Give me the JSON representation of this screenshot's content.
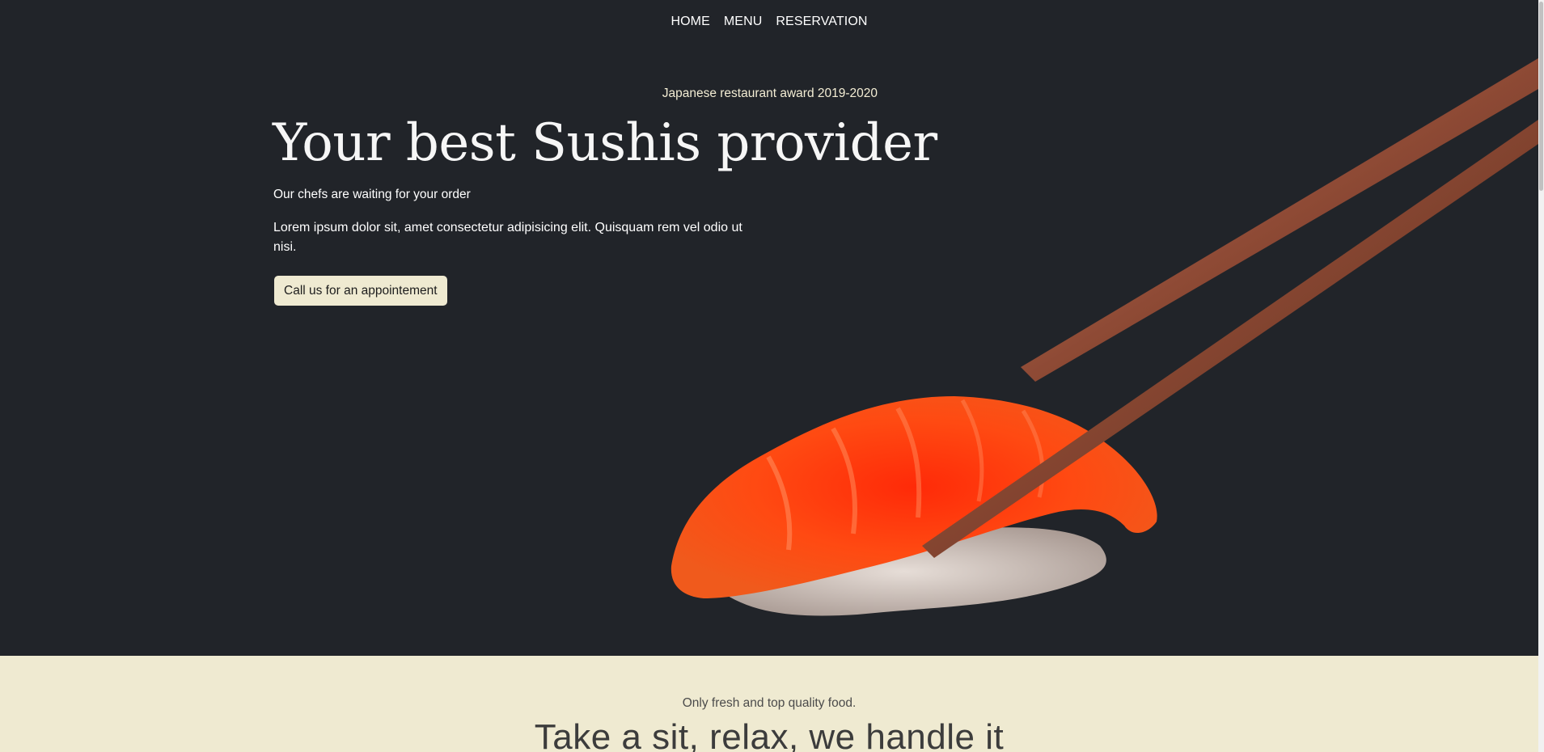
{
  "nav": {
    "items": [
      "HOME",
      "MENU",
      "RESERVATION"
    ]
  },
  "hero": {
    "award": "Japanese restaurant award 2019-2020",
    "headline": "Your best Sushis provider",
    "subhead": "Our chefs are waiting for your order",
    "lead": "Lorem ipsum dolor sit, amet consectetur adipisicing elit. Quisquam rem vel odio ut nisi.",
    "cta_label": "Call us for an appointement",
    "image": "sushi-with-chopsticks-image"
  },
  "section": {
    "tagline": "Only fresh and top quality food.",
    "title": "Take a sit, relax, we handle it"
  },
  "colors": {
    "hero_bg": "#212429",
    "cream": "#efead1",
    "text_light": "#ffffff"
  }
}
